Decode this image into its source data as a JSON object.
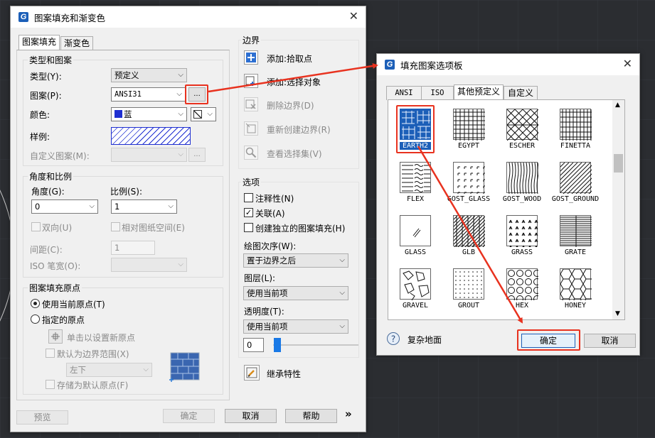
{
  "main_dialog": {
    "title": "图案填充和渐变色",
    "tabs": [
      {
        "label": "图案填充",
        "active": true
      },
      {
        "label": "渐变色",
        "active": false
      }
    ],
    "type_pattern_group": {
      "title": "类型和图案",
      "type_label": "类型(Y):",
      "type_value": "预定义",
      "pattern_label": "图案(P):",
      "pattern_value": "ANSI31",
      "browse_label": "...",
      "color_label": "颜色:",
      "color_value": "蓝",
      "color_swatch": "#1f2fd1",
      "sample_label": "样例:",
      "custom_label": "自定义图案(M):",
      "custom_browse_label": "..."
    },
    "angle_scale_group": {
      "title": "角度和比例",
      "angle_label": "角度(G):",
      "angle_value": "0",
      "scale_label": "比例(S):",
      "scale_value": "1",
      "double_label": "双向(U)",
      "relative_label": "相对图纸空间(E)",
      "spacing_label": "间距(C):",
      "spacing_value": "1",
      "iso_label": "ISO 笔宽(O):"
    },
    "origin_group": {
      "title": "图案填充原点",
      "use_current_label": "使用当前原点(T)",
      "use_current_selected": true,
      "specified_label": "指定的原点",
      "click_set_label": "单击以设置新原点",
      "default_extent_label": "默认为边界范围(X)",
      "position_value": "左下",
      "store_default_label": "存储为默认原点(F)"
    },
    "boundary_group": {
      "title": "边界",
      "add_pick_label": "添加:拾取点",
      "add_select_label": "添加:选择对象",
      "remove_label": "删除边界(D)",
      "recreate_label": "重新创建边界(R)",
      "view_label": "查看选择集(V)"
    },
    "options_group": {
      "title": "选项",
      "annotative_label": "注释性(N)",
      "annotative_checked": false,
      "associative_label": "关联(A)",
      "associative_checked": true,
      "separate_label": "创建独立的图案填充(H)",
      "separate_checked": false,
      "draw_order_label": "绘图次序(W):",
      "draw_order_value": "置于边界之后",
      "layer_label": "图层(L):",
      "layer_value": "使用当前项",
      "transparency_label": "透明度(T):",
      "transparency_value": "使用当前项",
      "transparency_number": "0"
    },
    "inherit_label": "继承特性",
    "footer": {
      "preview": "预览",
      "ok": "确定",
      "cancel": "取消",
      "help": "帮助",
      "expand": "»"
    }
  },
  "palette_dialog": {
    "title": "填充图案选项板",
    "tabs": [
      {
        "label": "ANSI",
        "active": false
      },
      {
        "label": "ISO",
        "active": false
      },
      {
        "label": "其他预定义",
        "active": true
      },
      {
        "label": "自定义",
        "active": false
      }
    ],
    "patterns": [
      "EARTH2",
      "EGYPT",
      "ESCHER",
      "FINETTA",
      "FLEX",
      "GOST_GLASS",
      "GOST_WOOD",
      "GOST_GROUND",
      "GLASS",
      "GLB",
      "GRASS",
      "GRATE",
      "GRAVEL",
      "GROUT",
      "HEX",
      "HONEY"
    ],
    "selected_pattern": "EARTH2",
    "status_label": "复杂地面",
    "ok": "确定",
    "cancel": "取消"
  },
  "colors": {
    "highlight": "#e8321f",
    "selection": "#1c5fb8",
    "accent": "#1c5fb8"
  }
}
